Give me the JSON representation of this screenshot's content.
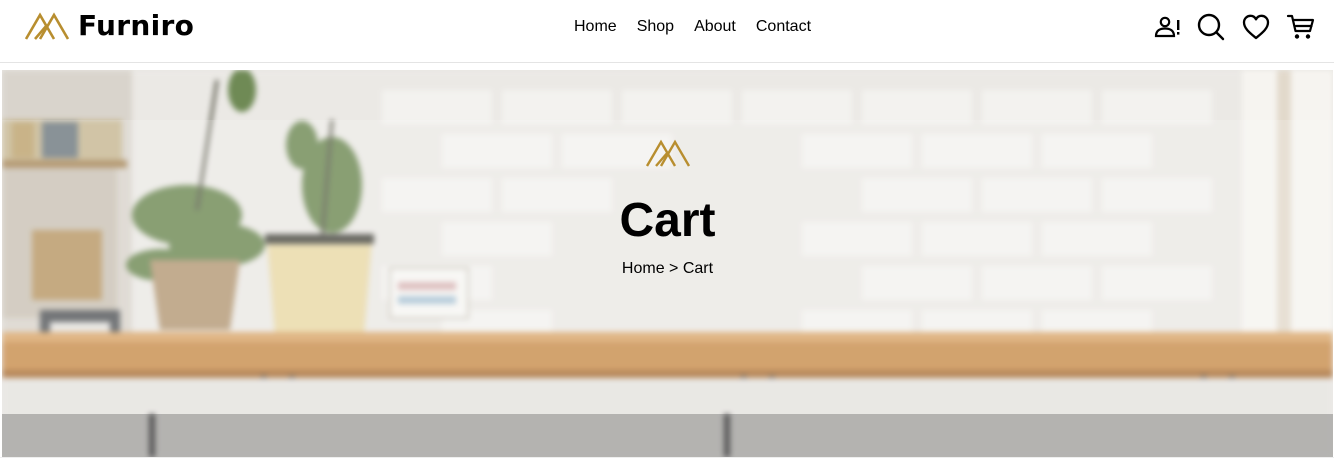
{
  "header": {
    "brand_name": "Furniro",
    "nav": [
      {
        "label": "Home"
      },
      {
        "label": "Shop"
      },
      {
        "label": "About"
      },
      {
        "label": "Contact"
      }
    ],
    "icons": [
      "account-alert-icon",
      "search-icon",
      "heart-icon",
      "cart-icon"
    ]
  },
  "banner": {
    "title": "Cart",
    "breadcrumb": {
      "home": "Home",
      "separator": ">",
      "current": "Cart"
    }
  },
  "colors": {
    "brand_gold": "#B88E2F",
    "text": "#000000",
    "header_border": "#E4E4E4"
  }
}
